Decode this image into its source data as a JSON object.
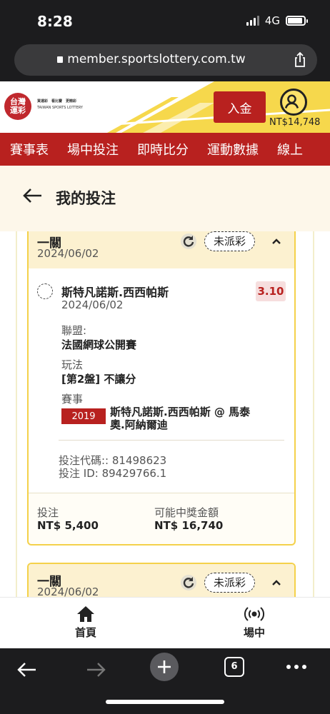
{
  "status": {
    "time": "8:28",
    "network": "4G"
  },
  "browser": {
    "url": "member.sportslottery.com.tw",
    "tab_count": "6"
  },
  "header": {
    "logo_line1": "台灣",
    "logo_line2": "運彩",
    "slogan": "買運彩　看比賽　更精彩",
    "brand_en": "TAIWAN SPORTS LOTTERY",
    "deposit_label": "入金",
    "balance": "NT$14,748"
  },
  "nav": {
    "items": [
      "賽事表",
      "場中投注",
      "即時比分",
      "運動數據",
      "線上"
    ]
  },
  "page": {
    "title": "我的投注"
  },
  "bets": [
    {
      "kind": "一關",
      "date": "2024/06/02",
      "status": "未派彩",
      "selection": "斯特凡諾斯.西西帕斯",
      "selection_date": "2024/06/02",
      "odds": "3.10",
      "league_label": "聯盟:",
      "league": "法國網球公開賽",
      "market_label": "玩法",
      "market": "[第2盤] 不讓分",
      "event_label": "賽事",
      "event_code": "2019",
      "event_name": "斯特凡諾斯.西西帕斯 @ 馬泰奧.阿納爾迪",
      "bet_code": "投注代碼:: 81498623",
      "bet_id": "投注 ID: 89429766.1",
      "stake_label": "投注",
      "stake": "NT$ 5,400",
      "payout_label": "可能中獎金額",
      "payout": "NT$ 16,740"
    },
    {
      "kind": "一關",
      "date": "2024/06/02",
      "status": "未派彩"
    }
  ],
  "appnav": {
    "home": "首頁",
    "live": "場中"
  },
  "colors": {
    "brand_red": "#b8211f",
    "accent_yellow": "#f4d14a",
    "title_bg": "#fdf7ea"
  }
}
